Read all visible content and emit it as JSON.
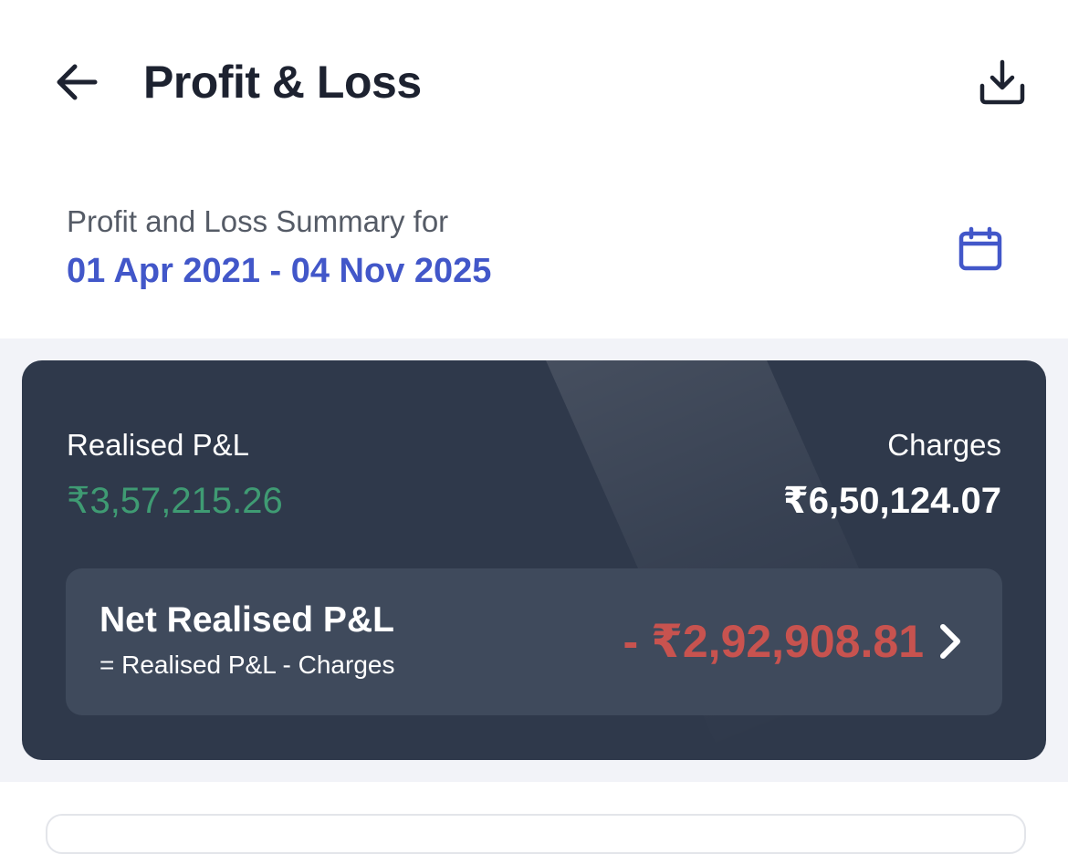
{
  "header": {
    "title": "Profit & Loss",
    "back_icon": "arrow-left-icon",
    "download_icon": "download-icon"
  },
  "summary": {
    "label": "Profit and Loss Summary for",
    "date_range": "01 Apr 2021 - 04 Nov 2025",
    "calendar_icon": "calendar-icon"
  },
  "pl_card": {
    "realised_label": "Realised P&L",
    "realised_value": "₹3,57,215.26",
    "charges_label": "Charges",
    "charges_value": "₹6,50,124.07",
    "net": {
      "label": "Net Realised P&L",
      "formula": "= Realised P&L - Charges",
      "value": "- ₹2,92,908.81",
      "chevron_icon": "chevron-right-icon"
    }
  },
  "colors": {
    "accent_blue": "#4257c9",
    "card_background": "#2f394b",
    "net_box_background": "#3f4a5c",
    "profit_green": "#3f9b73",
    "loss_red": "#c8534f",
    "band_background": "#f2f3f8"
  }
}
